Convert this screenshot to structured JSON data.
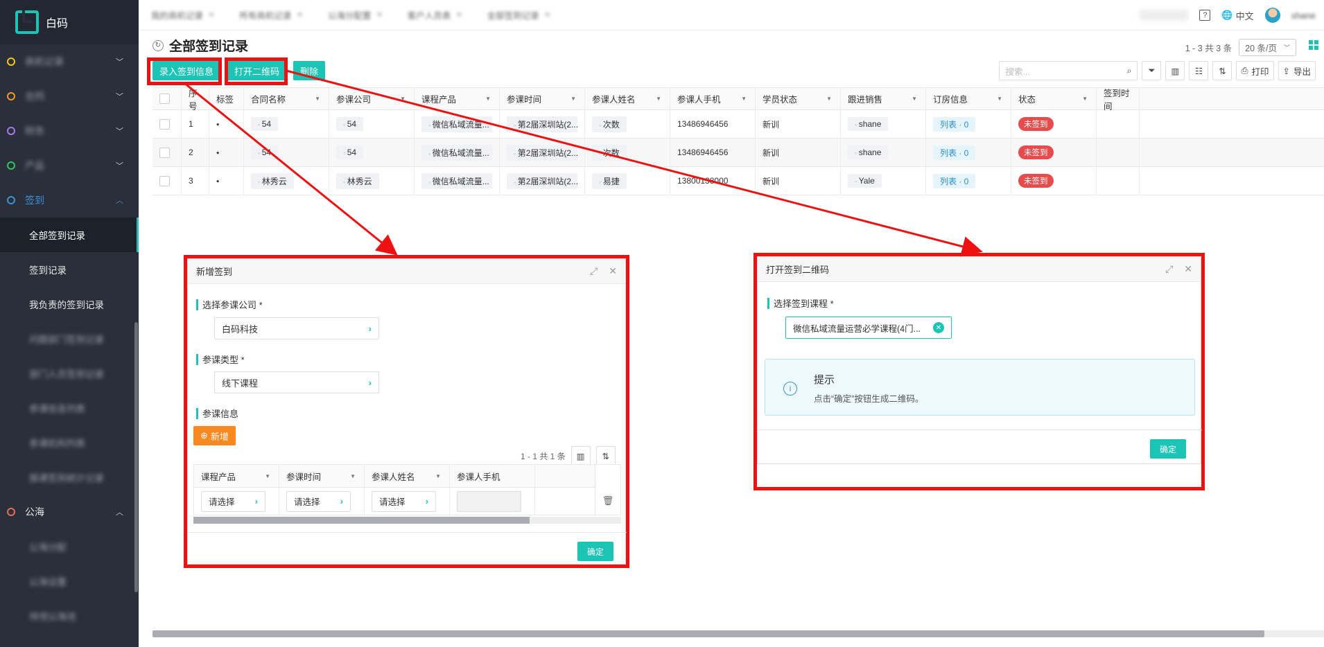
{
  "brand": {
    "name": "白码"
  },
  "sidebar": {
    "groups": [
      {
        "label": "商机记录",
        "color": "#f5c518",
        "blurred": true
      },
      {
        "label": "合同",
        "color": "#f59a23",
        "blurred": true
      },
      {
        "label": "财务",
        "color": "#a17cf0",
        "blurred": true
      },
      {
        "label": "产品",
        "color": "#2bc95a",
        "blurred": true
      }
    ],
    "signin": {
      "label": "签到",
      "color": "#3d8fd6"
    },
    "signin_items": [
      "全部签到记录",
      "签到记录",
      "我负责的签到记录"
    ],
    "blurred_items": [
      "问题部门签到记录",
      "部门人员签到记录",
      "参课信息列表",
      "参课机构列表",
      "报课签到统计记录"
    ],
    "public": {
      "label": "公海",
      "color": "#e86a5a"
    },
    "public_items": [
      "公海分配",
      "公海设置",
      "待领公海池"
    ]
  },
  "topbar": {
    "tabs": [
      "我的商机记录",
      "所有商机记录",
      "公海分配置",
      "客户人员表",
      "全部签到记录"
    ],
    "user": "shane",
    "lang": "中文"
  },
  "page": {
    "title": "全部签到记录"
  },
  "pager": {
    "summary": "1 - 3  共  3  条",
    "page_size": "20 条/页"
  },
  "toolbar": {
    "enter_label": "录入签到信息",
    "qr_label": "打开二维码",
    "delete_label": "删除",
    "search_placeholder": "搜索...",
    "print_label": "打印",
    "export_label": "导出"
  },
  "table": {
    "columns": [
      "序号",
      "标签",
      "合同名称",
      "参课公司",
      "课程产品",
      "参课时间",
      "参课人姓名",
      "参课人手机",
      "学员状态",
      "跟进销售",
      "订房信息",
      "状态",
      "签到时间"
    ],
    "rows": [
      {
        "no": "1",
        "contract": "54",
        "company": "54",
        "product": "微信私域流量...",
        "time": "第2届深圳站(2...",
        "name": "次数",
        "phone": "13486946456",
        "student_status": "新训",
        "sales": "shane",
        "booking": "列表 · 0",
        "status": "未签到",
        "signin_time": ""
      },
      {
        "no": "2",
        "contract": "54",
        "company": "54",
        "product": "微信私域流量...",
        "time": "第2届深圳站(2...",
        "name": "次数",
        "phone": "13486946456",
        "student_status": "新训",
        "sales": "shane",
        "booking": "列表 · 0",
        "status": "未签到",
        "signin_time": ""
      },
      {
        "no": "3",
        "contract": "林秀云",
        "company": "林秀云",
        "product": "微信私域流量...",
        "time": "第2届深圳站(2...",
        "name": "易捷",
        "phone": "13800138000",
        "student_status": "新训",
        "sales": "Yale",
        "booking": "列表 · 0",
        "status": "未签到",
        "signin_time": ""
      }
    ]
  },
  "dialog_add": {
    "title": "新增签到",
    "company_label": "选择参课公司 *",
    "company_value": "白码科技",
    "type_label": "参课类型 *",
    "type_value": "线下课程",
    "info_label": "参课信息",
    "add_button": "新增",
    "pager": "1 - 1  共  1  条",
    "columns": [
      "课程产品",
      "参课时间",
      "参课人姓名",
      "参课人手机"
    ],
    "row": [
      "请选择",
      "请选择",
      "请选择",
      ""
    ],
    "ok": "确定"
  },
  "dialog_qr": {
    "title": "打开签到二维码",
    "course_label": "选择签到课程 *",
    "course_value": "微信私域流量运营必学课程(4门...",
    "tip_title": "提示",
    "tip_text": "点击“确定”按钮生成二维码。",
    "ok": "确定"
  },
  "colors": {
    "accent": "#1cc4b5",
    "annotation": "#ee1111",
    "danger": "#e74c4c"
  }
}
